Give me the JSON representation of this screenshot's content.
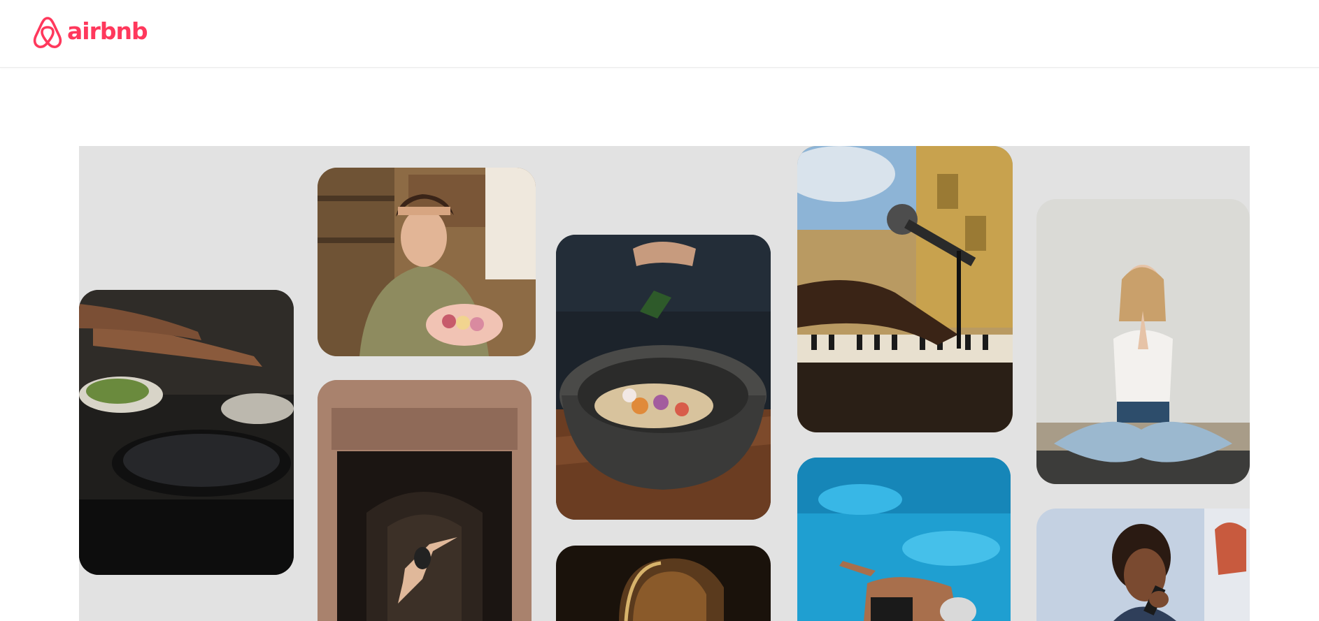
{
  "header": {
    "logo_text": "airbnb",
    "logo_icon": "airbnb-belo-icon",
    "brand_color": "#ff385c"
  },
  "mosaic": {
    "tiles": [
      {
        "name": "photo-cooking-pans"
      },
      {
        "name": "photo-woman-macarons"
      },
      {
        "name": "photo-dancer-archway"
      },
      {
        "name": "photo-seasoning-bowl"
      },
      {
        "name": "photo-guitar"
      },
      {
        "name": "photo-piano-microphone"
      },
      {
        "name": "photo-swimmer"
      },
      {
        "name": "photo-yoga"
      },
      {
        "name": "photo-singer"
      }
    ]
  }
}
